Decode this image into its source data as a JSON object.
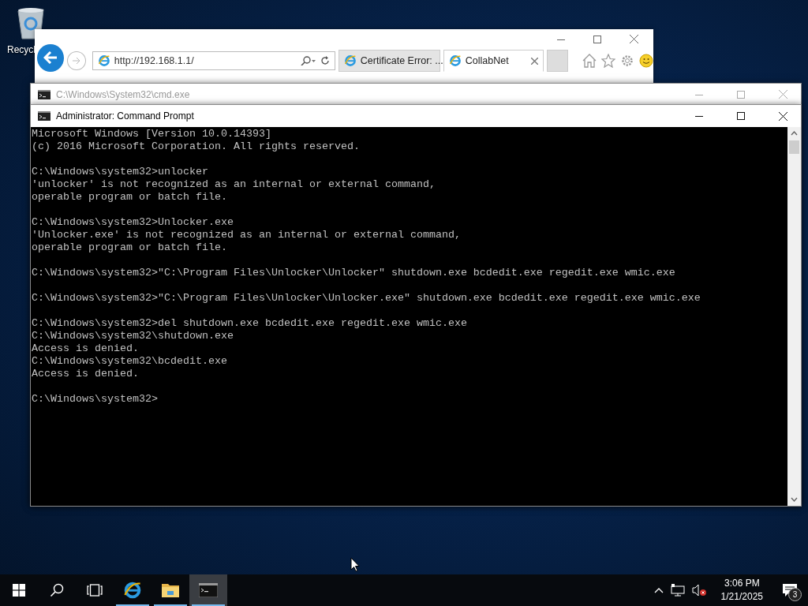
{
  "desktop": {
    "icons": [
      {
        "label": "Recycl"
      }
    ]
  },
  "browser": {
    "address": "http://192.168.1.1/",
    "tabs": [
      {
        "label": "Certificate Error: ...",
        "selected": false
      },
      {
        "label": "CollabNet",
        "selected": true
      }
    ]
  },
  "windows": [
    {
      "title": "C:\\Windows\\System32\\cmd.exe",
      "active": false
    },
    {
      "title": "Administrator: Command Prompt",
      "active": true
    }
  ],
  "console": {
    "blocks": [
      [
        "Microsoft Windows [Version 10.0.14393]",
        "(c) 2016 Microsoft Corporation. All rights reserved."
      ],
      [
        "C:\\Windows\\system32>unlocker",
        "'unlocker' is not recognized as an internal or external command,",
        "operable program or batch file."
      ],
      [
        "C:\\Windows\\system32>Unlocker.exe",
        "'Unlocker.exe' is not recognized as an internal or external command,",
        "operable program or batch file."
      ],
      [
        "C:\\Windows\\system32>\"C:\\Program Files\\Unlocker\\Unlocker\" shutdown.exe bcdedit.exe regedit.exe wmic.exe"
      ],
      [
        "C:\\Windows\\system32>\"C:\\Program Files\\Unlocker\\Unlocker.exe\" shutdown.exe bcdedit.exe regedit.exe wmic.exe"
      ],
      [
        "C:\\Windows\\system32>del shutdown.exe bcdedit.exe regedit.exe wmic.exe",
        "C:\\Windows\\system32\\shutdown.exe",
        "Access is denied.",
        "C:\\Windows\\system32\\bcdedit.exe",
        "Access is denied."
      ],
      [
        "C:\\Windows\\system32>"
      ]
    ]
  },
  "taskbar": {
    "items": [
      {
        "kind": "start",
        "running": false,
        "selected": false
      },
      {
        "kind": "search",
        "running": false,
        "selected": false
      },
      {
        "kind": "taskview",
        "running": false,
        "selected": false
      },
      {
        "kind": "browser",
        "running": true,
        "selected": false
      },
      {
        "kind": "folder",
        "running": true,
        "selected": false
      },
      {
        "kind": "console",
        "running": true,
        "selected": true
      }
    ],
    "time": "3:06 PM",
    "date": "1/21/2025",
    "notification_count": "3"
  }
}
